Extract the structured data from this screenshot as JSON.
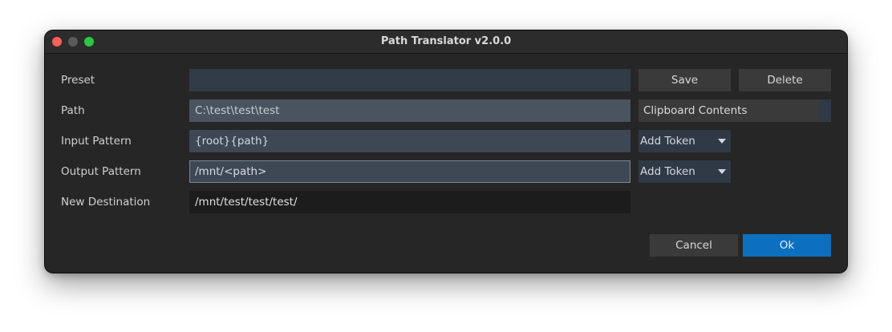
{
  "window": {
    "title": "Path Translator v2.0.0"
  },
  "form": {
    "preset": {
      "label": "Preset",
      "value": ""
    },
    "path": {
      "label": "Path",
      "value": "C:\\test\\test\\test"
    },
    "input_pattern": {
      "label": "Input Pattern",
      "value": "{root}{path}",
      "token_dropdown": "Add Token"
    },
    "output_pattern": {
      "label": "Output Pattern",
      "value": "/mnt/<path>",
      "token_dropdown": "Add Token"
    },
    "new_destination": {
      "label": "New Destination",
      "value": "/mnt/test/test/test/"
    }
  },
  "buttons": {
    "save": "Save",
    "delete": "Delete",
    "clipboard": "Clipboard Contents",
    "cancel": "Cancel",
    "ok": "Ok"
  },
  "icons": {
    "close": "close-window-icon",
    "minimize": "minimize-window-icon",
    "maximize": "maximize-window-icon",
    "dropdown": "caret-down-icon"
  },
  "colors": {
    "window_bg": "#262626",
    "accent": "#0c6fbf",
    "close": "#fe5f57",
    "maximize": "#2ac840"
  }
}
